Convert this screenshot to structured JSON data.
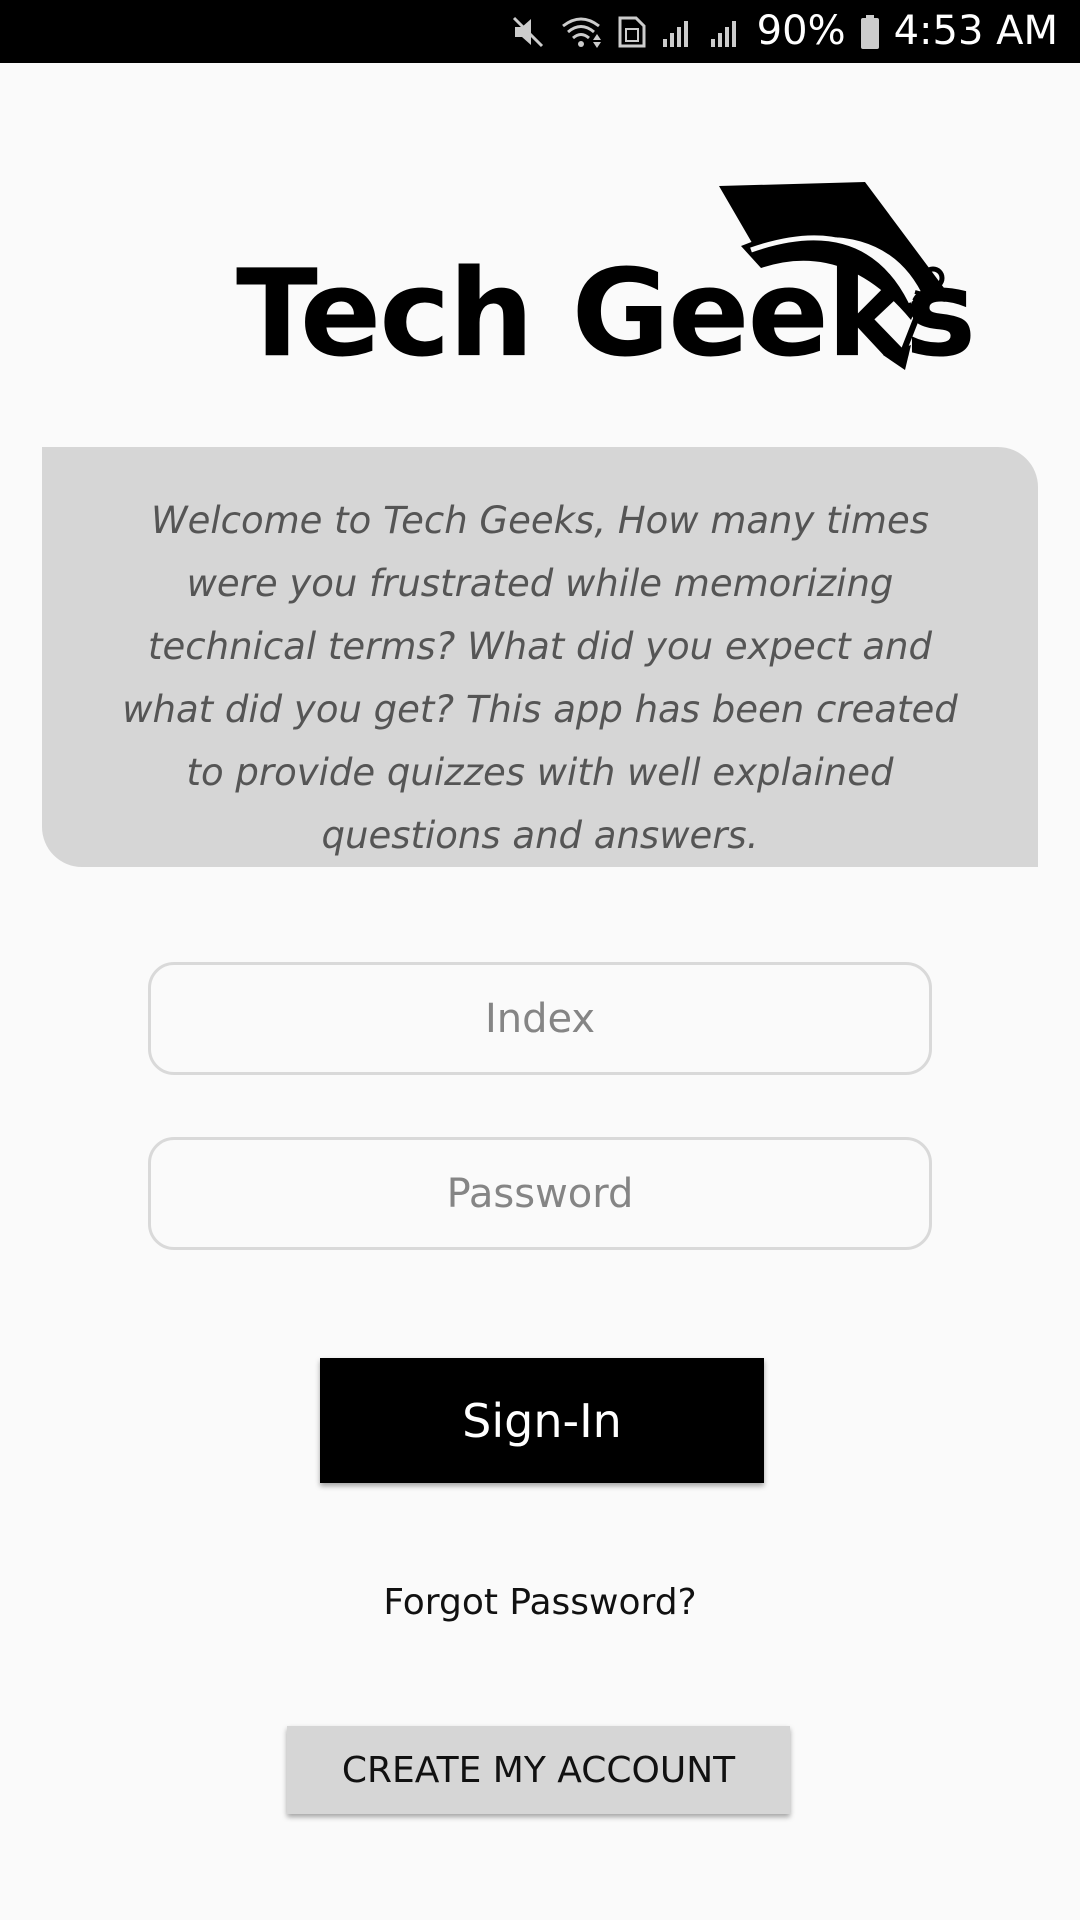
{
  "status_bar": {
    "battery_percent": "90%",
    "time": "4:53 AM",
    "icons": [
      "mute-icon",
      "wifi-icon",
      "sim-icon",
      "signal-icon",
      "signal-icon",
      "battery-icon"
    ]
  },
  "logo": {
    "app_name": "Tech Geeks",
    "icon": "graduation-cap-icon"
  },
  "welcome": {
    "text": "Welcome to Tech Geeks, How many times were you frustrated while memorizing technical terms? What did you expect and what did you get? This app has been created to provide quizzes with well explained questions and answers."
  },
  "form": {
    "index_placeholder": "Index",
    "index_value": "",
    "password_placeholder": "Password",
    "password_value": "",
    "signin_label": "Sign-In",
    "forgot_label": "Forgot Password?",
    "create_label": "CREATE MY ACCOUNT"
  },
  "colors": {
    "background": "#fafafa",
    "card": "#d6d6d6",
    "primary_button": "#000000",
    "secondary_button": "#d6d6d6"
  }
}
